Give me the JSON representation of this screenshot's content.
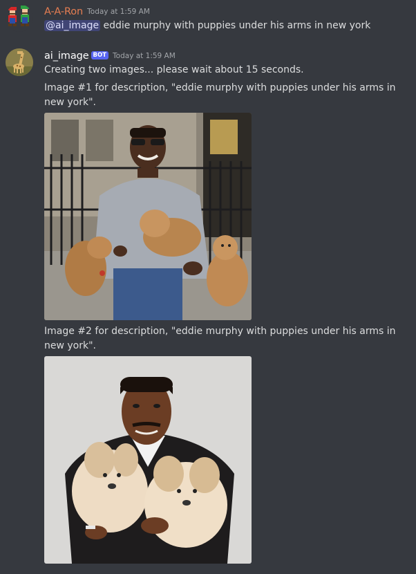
{
  "messages": [
    {
      "username": "A-A-Ron",
      "username_color": "#e67e52",
      "timestamp": "Today at 1:59 AM",
      "mention": "@ai_image",
      "text": " eddie murphy with puppies under his arms in new york"
    },
    {
      "username": "ai_image",
      "username_color": "#ffffff",
      "bot_tag": "BOT",
      "timestamp": "Today at 1:59 AM",
      "status_line": "Creating two images... please wait about 15 seconds.",
      "image1_caption": "Image #1 for description, \"eddie murphy with puppies under his arms in new york\".",
      "image2_caption": "Image #2 for description, \"eddie murphy with puppies under his arms in new york\"."
    }
  ],
  "colors": {
    "background": "#36393f",
    "text": "#dcddde",
    "timestamp": "#a3a6aa",
    "bot_tag": "#5865f2",
    "mention_bg": "#414675"
  },
  "icons": {
    "user_avatar": "mario-luigi-avatar-icon",
    "bot_avatar": "giraffe-avatar-icon"
  }
}
